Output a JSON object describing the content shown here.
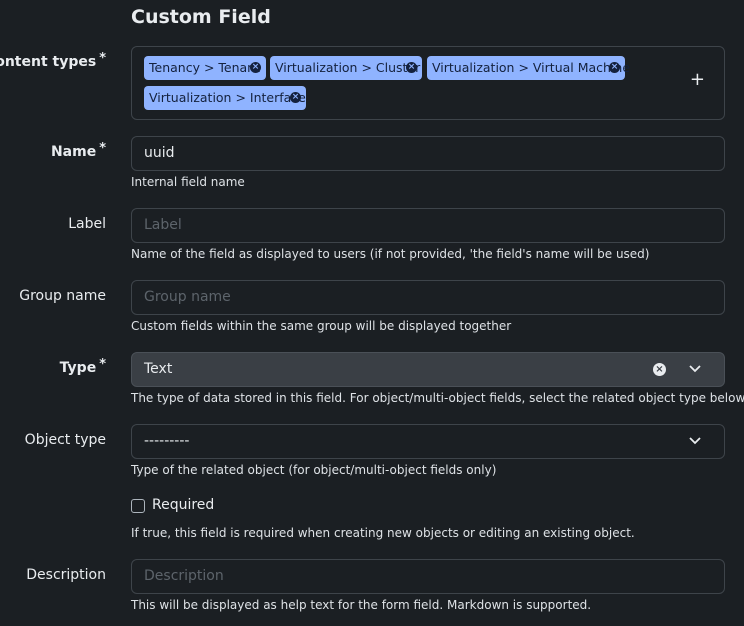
{
  "page": {
    "title": "Custom Field"
  },
  "content_types": {
    "label": "Content types",
    "required_mark": "*",
    "tags": [
      "Tenancy > Tenant",
      "Virtualization > Cluster",
      "Virtualization > Virtual Machine",
      "Virtualization > Interface"
    ],
    "remove_glyph": "×",
    "add_glyph": "+"
  },
  "name": {
    "label": "Name",
    "required_mark": "*",
    "value": "uuid",
    "help": "Internal field name"
  },
  "label_field": {
    "label": "Label",
    "placeholder": "Label",
    "help": "Name of the field as displayed to users (if not provided, 'the field's name will be used)"
  },
  "group_name": {
    "label": "Group name",
    "placeholder": "Group name",
    "help": "Custom fields within the same group will be displayed together"
  },
  "type": {
    "label": "Type",
    "required_mark": "*",
    "value": "Text",
    "clear_glyph": "×",
    "help": "The type of data stored in this field. For object/multi-object fields, select the related object type below."
  },
  "object_type": {
    "label": "Object type",
    "value": "---------",
    "help": "Type of the related object (for object/multi-object fields only)"
  },
  "required": {
    "label": "Required",
    "checked": false,
    "help": "If true, this field is required when creating new objects or editing an existing object."
  },
  "description": {
    "label": "Description",
    "placeholder": "Description",
    "help": "This will be displayed as help text for the form field. Markdown is supported."
  }
}
